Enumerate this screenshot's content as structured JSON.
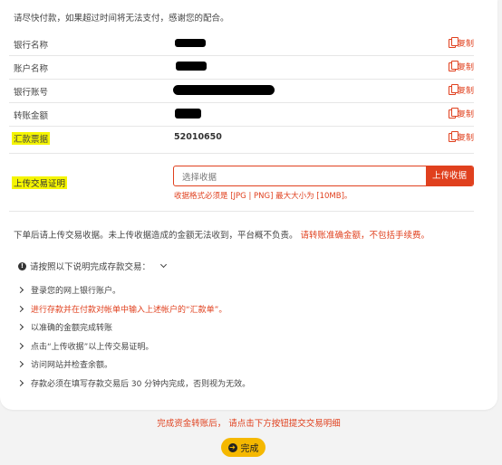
{
  "notice": "请尽快付款，如果超过时间将无法支付，感谢您的配合。",
  "fields": [
    {
      "label": "银行名称",
      "value": "",
      "copy": "复制"
    },
    {
      "label": "账户名称",
      "value": "",
      "copy": "复制"
    },
    {
      "label": "银行账号",
      "value": "",
      "copy": "复制"
    },
    {
      "label": "转账金额",
      "value": "",
      "copy": "复制"
    },
    {
      "label": "汇款票据",
      "value": "52010650",
      "copy": "复制"
    }
  ],
  "upload": {
    "label": "上传交易证明",
    "placeholder": "选择收据",
    "button": "上传收据",
    "hint": "收据格式必须是 [JPG | PNG] 最大大小为 [10MB]。"
  },
  "after_note": {
    "text": "下单后请上传交易收据。未上传收据造成的金额无法收到，平台概不负责。",
    "red": "请转账准确金额，不包括手续费。"
  },
  "instructions": {
    "title": "请按照以下说明完成存款交易：",
    "steps": [
      {
        "text": "登录您的网上银行账户。",
        "red": false
      },
      {
        "text": "进行存款并在付款对帐单中输入上述帐户的“汇款单”。",
        "red": true
      },
      {
        "text": "以准确的金额完成转账",
        "red": false
      },
      {
        "text": "点击“上传收据”以上传交易证明。",
        "red": false
      },
      {
        "text": "访问网站并检查余额。",
        "red": false
      },
      {
        "text": "存款必须在填写存款交易后 30 分钟内完成，否则视为无效。",
        "red": false
      }
    ]
  },
  "bottom_note": "完成资金转账后， 请点击下方按钮提交交易明细",
  "done_button": "完成",
  "colors": {
    "accent": "#e0401e",
    "highlight": "#f5f500",
    "button": "#f5b800"
  }
}
